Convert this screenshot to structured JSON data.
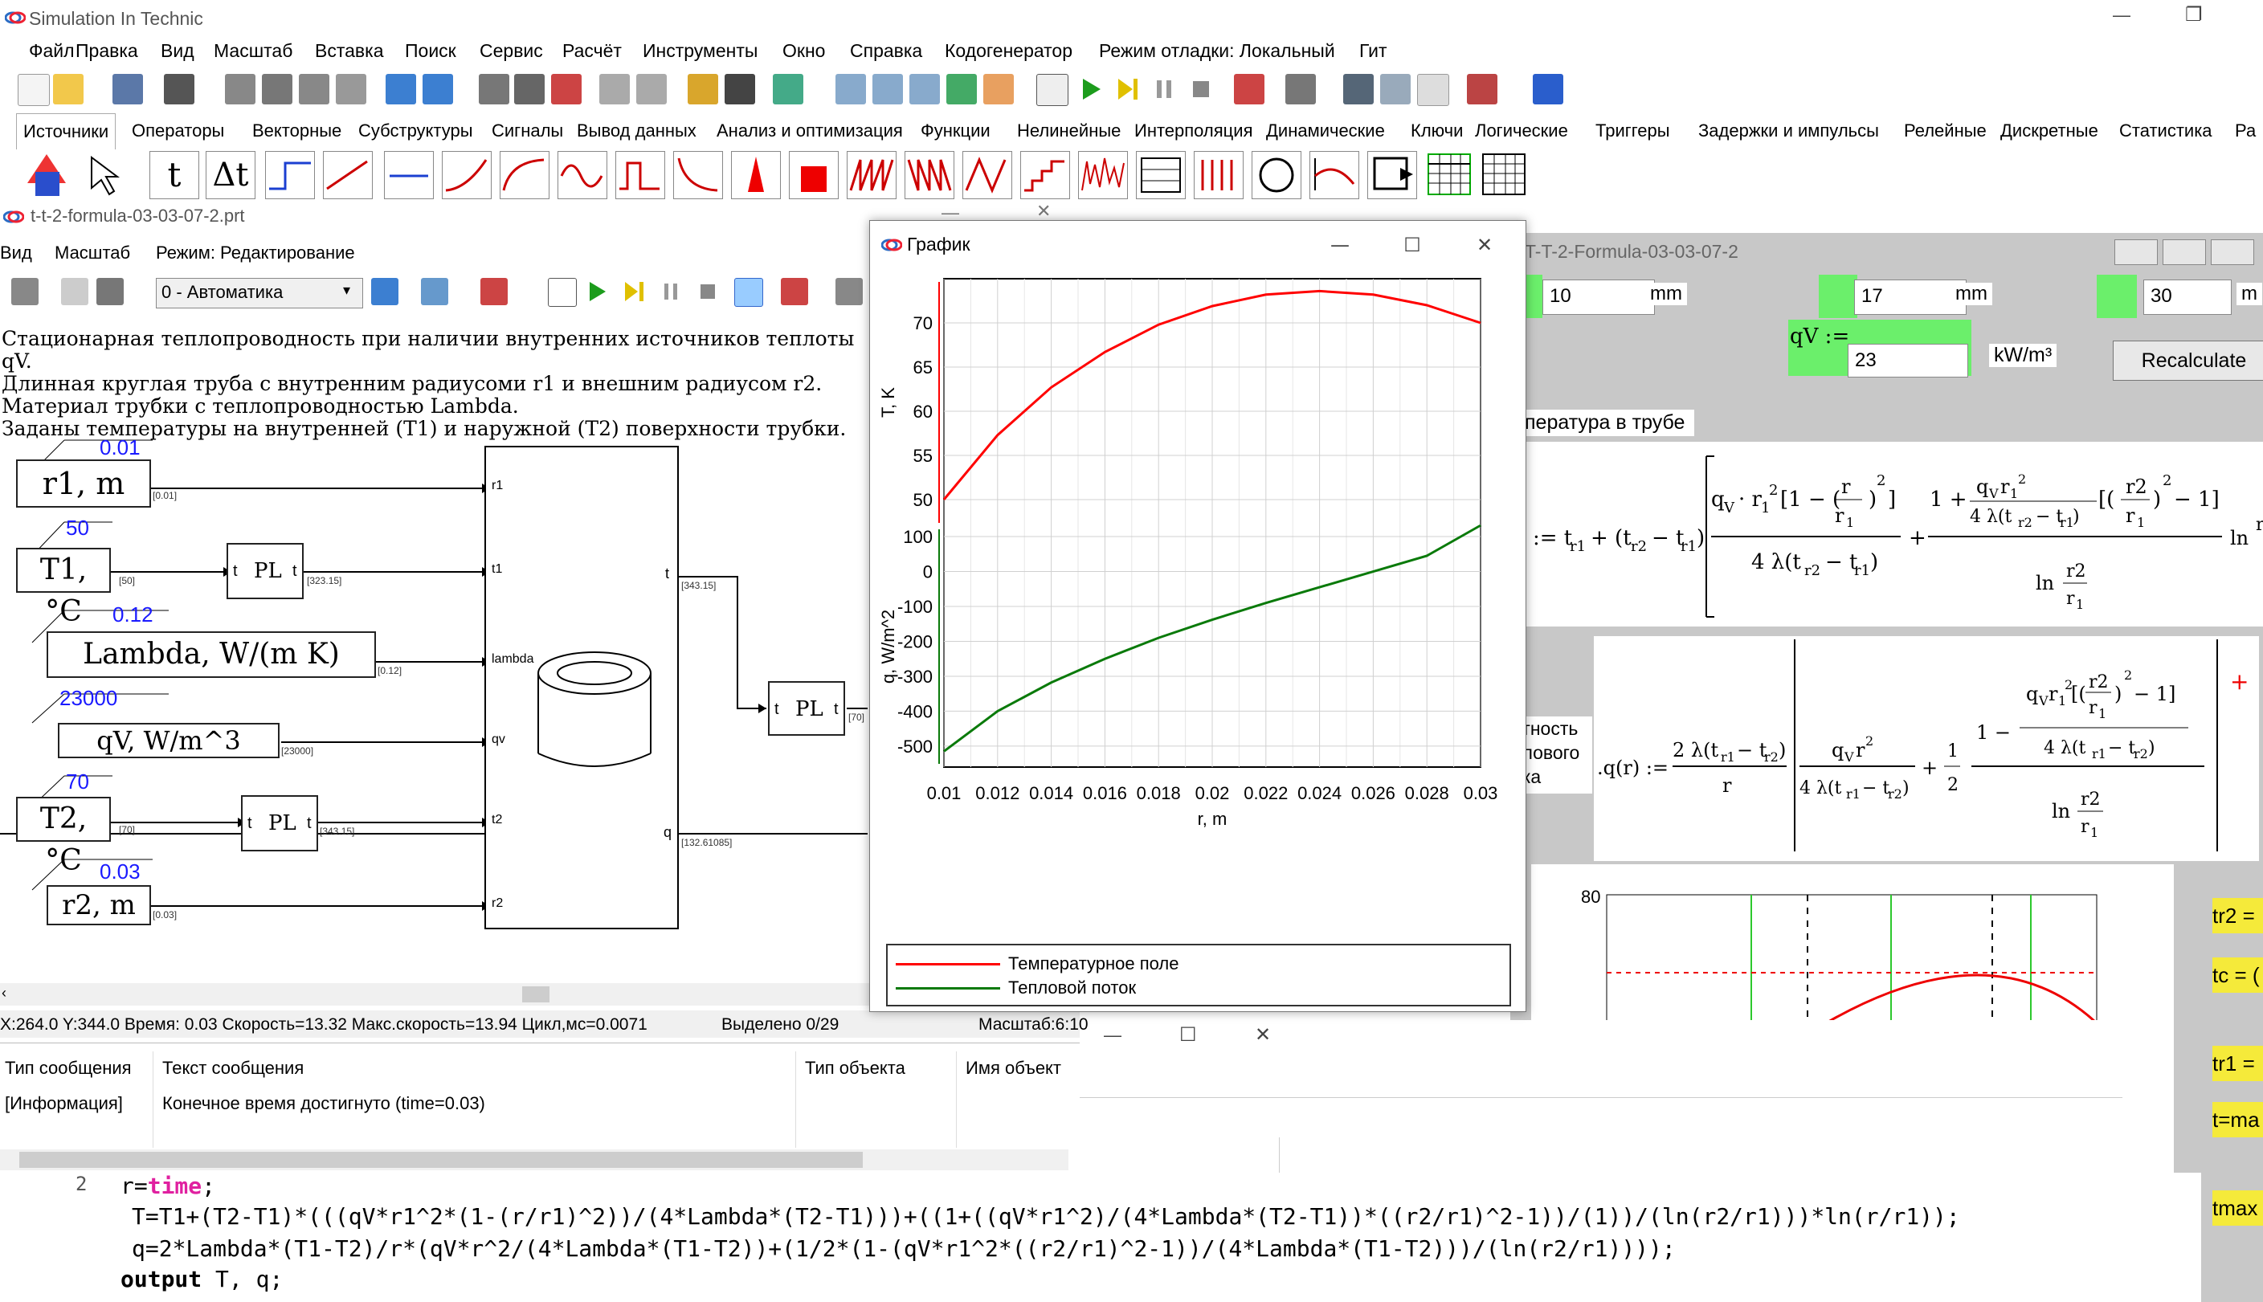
{
  "app": {
    "title": "Simulation In Technic",
    "menu": [
      "Файл",
      "Правка",
      "Вид",
      "Масштаб",
      "Вставка",
      "Поиск",
      "Сервис",
      "Расчёт",
      "Инструменты",
      "Окно",
      "Справка",
      "Кодогенератор",
      "Режим отладки: Локальный",
      "Гит"
    ],
    "minimize": "—",
    "restore": "❐"
  },
  "tabs": [
    "Источники",
    "Операторы",
    "Векторные",
    "Субструктуры",
    "Сигналы",
    "Вывод данных",
    "Анализ и оптимизация",
    "Функции",
    "Нелинейные",
    "Интерполяция",
    "Динамические",
    "Ключи",
    "Логические",
    "Триггеры",
    "Задержки и импульсы",
    "Релейные",
    "Дискретные",
    "Статистика",
    "Ра"
  ],
  "palette": {
    "t": "t",
    "dt": "Δt"
  },
  "scheme": {
    "title": "t-t-2-formula-03-03-07-2.prt",
    "menu": [
      "Вид",
      "Масштаб",
      "Режим:  Редактирование"
    ],
    "mode_select": "0 - Автоматика",
    "description": [
      "Стационарная теплопроводность при наличии внутренних источников теплоты qV.",
      "Длинная круглая труба с внутренним радиусоми r1 и внешним радиусом r2.",
      "Материал трубки с теплопроводностью Lambda.",
      "Заданы температуры на внутренней (T1) и наружной (T2) поверхности трубки."
    ],
    "blocks": {
      "r1": {
        "value": "0.01",
        "label": "r1, m",
        "out": "[0.01]"
      },
      "t1": {
        "value": "50",
        "label": "T1, °C",
        "out": "[50]",
        "pl_out": "[323.15]"
      },
      "lambda": {
        "value": "0.12",
        "label": "Lambda, W/(m K)",
        "out": "[0.12]"
      },
      "qv": {
        "value": "23000",
        "label": "qV, W/m^3",
        "out": "[23000]"
      },
      "t2": {
        "value": "70",
        "label": "T2, °C",
        "out": "[70]",
        "pl_out": "[343.15]"
      },
      "r2": {
        "value": "0.03",
        "label": "r2, m",
        "out": "[0.03]"
      },
      "pl": "PL",
      "pl_t": "t",
      "main_ports_in": [
        "r1",
        "t1",
        "lambda",
        "qv",
        "t2",
        "r2"
      ],
      "main_ports_out": [
        "t",
        "q"
      ],
      "out_t": "[343.15]",
      "out_q": "[132.61085]",
      "pl3_out": "[70]"
    },
    "status": {
      "coords": "X:264.0  Y:344.0  Время: 0.03  Скорость=13.32  Макс.скорость=13.94  Цикл,мс=0.0071",
      "selected": "Выделено 0/29",
      "scale": "Масштаб:6:10"
    }
  },
  "messages": {
    "headers": [
      "Тип сообщения",
      "Текст сообщения",
      "Тип объекта",
      "Имя объект"
    ],
    "rows": [
      {
        "type": "[Информация]",
        "text": "Конечное время достигнуто (time=0.03)"
      }
    ]
  },
  "graph": {
    "title": "График",
    "legend": [
      {
        "name": "Температурное поле",
        "color": "#ff0000"
      },
      {
        "name": "Тепловой поток",
        "color": "#0a7a0a"
      }
    ]
  },
  "chart_data": [
    {
      "type": "line",
      "ylabel": "T, K",
      "xlabel": "",
      "ylim": [
        47,
        75
      ],
      "yticks": [
        "50",
        "55",
        "60",
        "65",
        "70"
      ],
      "x": [
        0.01,
        0.012,
        0.014,
        0.016,
        0.018,
        0.02,
        0.022,
        0.024,
        0.026,
        0.028,
        0.03
      ],
      "series": [
        {
          "name": "Температурное поле",
          "color": "#ff0000",
          "values": [
            50.0,
            57.3,
            62.7,
            66.7,
            69.8,
            71.9,
            73.2,
            73.6,
            73.2,
            72.0,
            70.0
          ]
        }
      ]
    },
    {
      "type": "line",
      "ylabel": "q, W/m^2",
      "xlabel": "r, m",
      "ylim": [
        -560,
        130
      ],
      "yticks": [
        "100",
        "0",
        "-100",
        "-200",
        "-300",
        "-400",
        "-500"
      ],
      "xticks": [
        "0.01",
        "0.012",
        "0.014",
        "0.016",
        "0.018",
        "0.02",
        "0.022",
        "0.024",
        "0.026",
        "0.028",
        "0.03"
      ],
      "x": [
        0.01,
        0.012,
        0.014,
        0.016,
        0.018,
        0.02,
        0.022,
        0.024,
        0.026,
        0.028,
        0.03
      ],
      "series": [
        {
          "name": "Тепловой поток",
          "color": "#0a7a0a",
          "values": [
            -515,
            -400,
            -318,
            -250,
            -190,
            -138,
            -90,
            -45,
            0,
            45,
            132
          ]
        }
      ]
    }
  ],
  "formula_window": {
    "title": "T-T-2-Formula-03-03-07-2",
    "inputs": [
      {
        "value": "10",
        "unit": "mm"
      },
      {
        "value": "17",
        "unit": "mm"
      },
      {
        "value": "30",
        "unit": "m"
      }
    ],
    "qv_label": "qV :=",
    "qv_value": "23",
    "qv_unit": "kW/m³",
    "recalculate": "Recalculate",
    "section_title": "пература в трубе",
    "flux_label": [
      "отность",
      "плового",
      "ока"
    ],
    "plot_ymax": "80",
    "right_labels": [
      "tr2 =",
      "tc = (",
      "tr1 =",
      "t=ma",
      "tmax"
    ]
  },
  "code": {
    "line_num": "2",
    "lines": [
      "r=time;",
      "T=T1+(T2-T1)*(((qV*r1^2*(1-(r/r1)^2))/(4*Lambda*(T2-T1)))+((1+((qV*r1^2)/(4*Lambda*(T2-T1))*((r2/r1)^2-1))/(1))/(ln(r2/r1)))*ln(r/r1));",
      "q=2*Lambda*(T1-T2)/r*(qV*r^2/(4*Lambda*(T1-T2))+(1/2*(1-(qV*r1^2*((r2/r1)^2-1))/(4*Lambda*(T1-T2)))/(ln(r2/r1))));",
      "output T, q;"
    ]
  }
}
